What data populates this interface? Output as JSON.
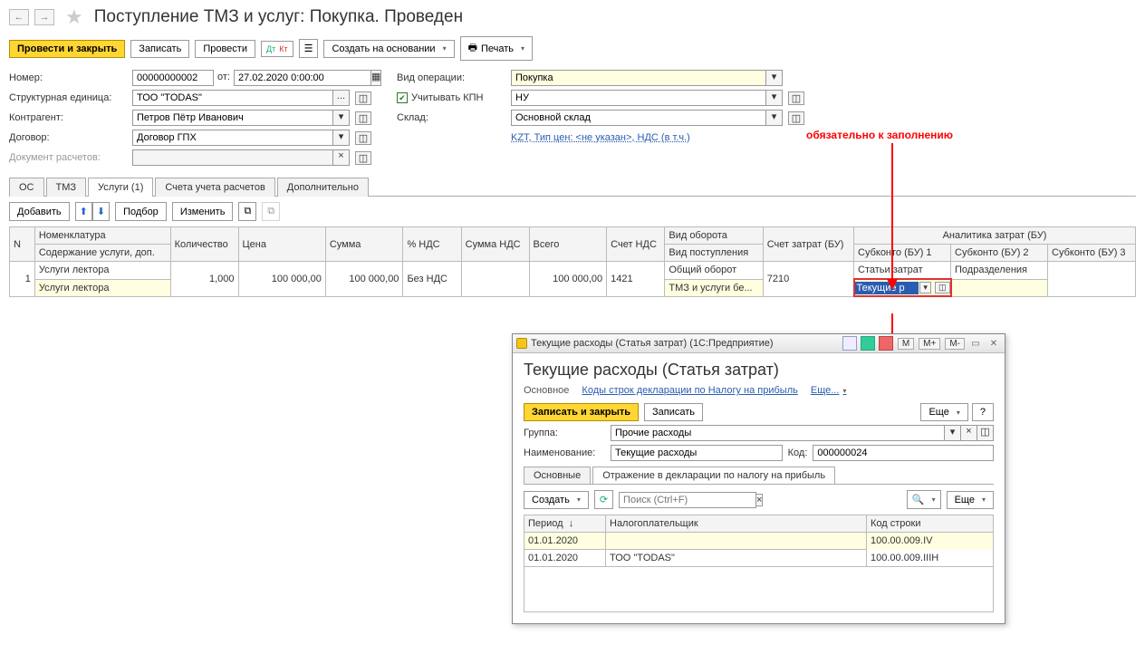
{
  "header": {
    "title": "Поступление ТМЗ и услуг: Покупка. Проведен"
  },
  "toolbar": {
    "post_close": "Провести и закрыть",
    "write": "Записать",
    "post": "Провести",
    "create_based": "Создать на основании",
    "print": "Печать"
  },
  "form": {
    "number_label": "Номер:",
    "number": "00000000002",
    "date_label": "от:",
    "date": "27.02.2020 0:00:00",
    "op_label": "Вид операции:",
    "op": "Покупка",
    "unit_label": "Структурная единица:",
    "unit": "ТОО \"TODAS\"",
    "kpn_label": "Учитывать КПН",
    "kpn": "НУ",
    "cp_label": "Контрагент:",
    "cp": "Петров Пётр Иванович",
    "wh_label": "Склад:",
    "wh": "Основной склад",
    "contract_label": "Договор:",
    "contract": "Договор ГПХ",
    "price_info": "KZT, Тип цен: <не указан>, НДС (в т.ч.)",
    "doc_label": "Документ расчетов:"
  },
  "tabs": {
    "os": "ОС",
    "tmz": "ТМЗ",
    "services": "Услуги (1)",
    "accounts": "Счета учета расчетов",
    "more": "Дополнительно"
  },
  "sub": {
    "add": "Добавить",
    "pick": "Подбор",
    "edit": "Изменить"
  },
  "grid": {
    "h": {
      "n": "N",
      "nom": "Номенклатура",
      "nom2": "Содержание услуги, доп.",
      "qty": "Количество",
      "price": "Цена",
      "sum": "Сумма",
      "vat": "% НДС",
      "vatsum": "Сумма НДС",
      "total": "Всего",
      "vatacc": "Счет НДС",
      "turn": "Вид оборота",
      "turn2": "Вид поступления",
      "costacc": "Счет затрат (БУ)",
      "anal": "Аналитика затрат (БУ)",
      "s1": "Субконто (БУ) 1",
      "s2": "Субконто (БУ) 2",
      "s3": "Субконто (БУ) 3"
    },
    "r": {
      "n": "1",
      "nom": "Услуги лектора",
      "nom2": "Услуги лектора",
      "qty": "1,000",
      "price": "100 000,00",
      "sum": "100 000,00",
      "vat": "Без НДС",
      "vatsum": "",
      "total": "100 000,00",
      "vatacc": "1421",
      "turn": "Общий оборот",
      "turn2": "ТМЗ и услуги бе...",
      "costacc": "7210",
      "s1": "Статьи затрат",
      "s1v": "Текущие р",
      "s2": "Подразделения",
      "s3": ""
    }
  },
  "annot": {
    "text": "обязательно к заполнению"
  },
  "dlg": {
    "titlebar": "Текущие расходы (Статья затрат)  (1С:Предприятие)",
    "mbtns": {
      "m": "M",
      "mp": "M+",
      "mm": "M-"
    },
    "title": "Текущие расходы (Статья затрат)",
    "nav_main": "Основное",
    "nav_codes": "Коды строк декларации по Налогу на прибыль",
    "nav_more": "Еще...",
    "tb": {
      "writeclose": "Записать и закрыть",
      "write": "Записать",
      "more": "Еще",
      "help": "?"
    },
    "group_label": "Группа:",
    "group": "Прочие расходы",
    "name_label": "Наименование:",
    "name": "Текущие расходы",
    "code_label": "Код:",
    "code": "000000024",
    "tabs": {
      "main": "Основные",
      "decl": "Отражение в декларации по налогу на прибыль"
    },
    "bar": {
      "create": "Создать",
      "search_ph": "Поиск (Ctrl+F)",
      "more": "Еще"
    },
    "dgrid": {
      "h": {
        "period": "Период",
        "tax": "Налогоплательщик",
        "code": "Код строки"
      },
      "rows": [
        {
          "period": "01.01.2020",
          "tax": "",
          "code": "100.00.009.IV"
        },
        {
          "period": "01.01.2020",
          "tax": "ТОО \"TODAS\"",
          "code": "100.00.009.IIIH"
        }
      ]
    }
  }
}
